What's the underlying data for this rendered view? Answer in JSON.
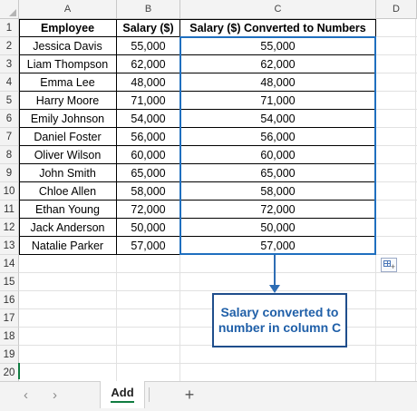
{
  "spreadsheet": {
    "columns": [
      "A",
      "B",
      "C",
      "D"
    ],
    "rows": [
      "1",
      "2",
      "3",
      "4",
      "5",
      "6",
      "7",
      "8",
      "9",
      "10",
      "11",
      "12",
      "13",
      "14",
      "15",
      "16",
      "17",
      "18",
      "19",
      "20"
    ],
    "table": {
      "headers": [
        "Employee",
        "Salary ($)",
        "Salary ($) Converted to Numbers"
      ],
      "data": [
        [
          "Jessica Davis",
          "55,000",
          "55,000"
        ],
        [
          "Liam Thompson",
          "62,000",
          "62,000"
        ],
        [
          "Emma Lee",
          "48,000",
          "48,000"
        ],
        [
          "Harry Moore",
          "71,000",
          "71,000"
        ],
        [
          "Emily Johnson",
          "54,000",
          "54,000"
        ],
        [
          "Daniel Foster",
          "56,000",
          "56,000"
        ],
        [
          "Oliver Wilson",
          "60,000",
          "60,000"
        ],
        [
          "John Smith",
          "65,000",
          "65,000"
        ],
        [
          "Chloe Allen",
          "58,000",
          "58,000"
        ],
        [
          "Ethan Young",
          "72,000",
          "72,000"
        ],
        [
          "Jack Anderson",
          "50,000",
          "50,000"
        ],
        [
          "Natalie Parker",
          "57,000",
          "57,000"
        ]
      ]
    }
  },
  "annotation": {
    "text": "Salary converted to number in column C",
    "border_color": "#1f4e8c",
    "text_color": "#1f5fa8",
    "arrow_color": "#2e6db4"
  },
  "selection": {
    "color": "#1f6fbf"
  },
  "sheet_tabs": {
    "prev_icon": "‹",
    "next_icon": "›",
    "active_tab": "Add",
    "add_icon": "+",
    "accent": "#107c41"
  }
}
